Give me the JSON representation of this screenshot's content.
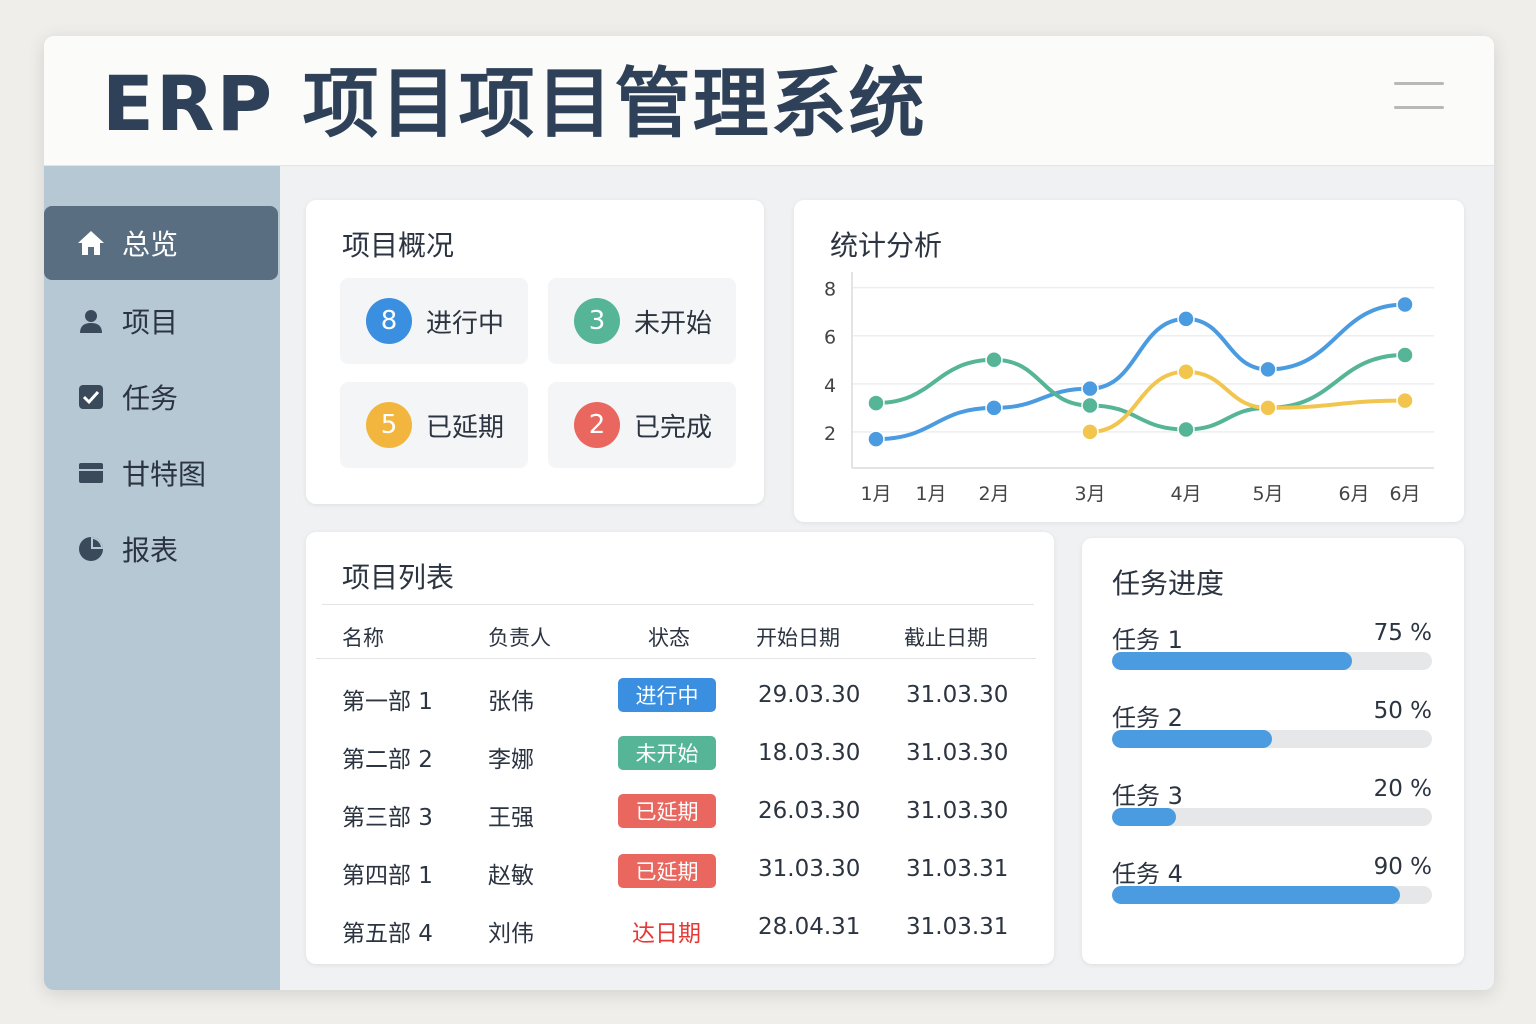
{
  "app": {
    "title": "ERP   项目项目管理系统"
  },
  "sidebar": {
    "items": [
      {
        "label": "总览",
        "icon": "home-icon"
      },
      {
        "label": "项目",
        "icon": "user-icon"
      },
      {
        "label": "任务",
        "icon": "checkbox-icon"
      },
      {
        "label": "甘特图",
        "icon": "gantt-icon"
      },
      {
        "label": "报表",
        "icon": "pie-chart-icon"
      }
    ]
  },
  "overview": {
    "title": "项目概况",
    "stats": [
      {
        "count": "8",
        "label": "进行中",
        "color": "#3a8fe0"
      },
      {
        "count": "3",
        "label": "未开始",
        "color": "#55b596"
      },
      {
        "count": "5",
        "label": "已延期",
        "color": "#f2b53d"
      },
      {
        "count": "2",
        "label": "已完成",
        "color": "#e9675f"
      }
    ]
  },
  "chart": {
    "title": "统计分析"
  },
  "chart_data": {
    "type": "line",
    "title": "统计分析",
    "x": [
      "1月",
      "1月",
      "2月",
      "3月",
      "4月",
      "5月",
      "6月",
      "6月"
    ],
    "yticks": [
      2,
      4,
      6,
      8
    ],
    "ylim": [
      0.5,
      8.4
    ],
    "grid": true,
    "series": [
      {
        "color": "#4a9be0",
        "points": [
          [
            0,
            1.7
          ],
          [
            2,
            3.0
          ],
          [
            3,
            3.8
          ],
          [
            4,
            6.7
          ],
          [
            5,
            4.6
          ],
          [
            7,
            7.3
          ]
        ]
      },
      {
        "color": "#55b596",
        "points": [
          [
            0,
            3.2
          ],
          [
            2,
            5.0
          ],
          [
            3,
            3.1
          ],
          [
            4,
            2.1
          ],
          [
            5,
            3.0
          ],
          [
            7,
            5.2
          ]
        ]
      },
      {
        "color": "#f2c64e",
        "points": [
          [
            3,
            2.0
          ],
          [
            4,
            4.5
          ],
          [
            5,
            3.0
          ],
          [
            7,
            3.3
          ]
        ]
      }
    ]
  },
  "project_list": {
    "title": "项目列表",
    "columns": [
      "名称",
      "负责人",
      "状态",
      "开始日期",
      "截止日期"
    ],
    "rows": [
      {
        "name": "第一部 1",
        "owner": "张伟",
        "status": "进行中",
        "status_color": "#3a8fe0",
        "start": "29.03.30",
        "end": "31.03.30"
      },
      {
        "name": "第二部 2",
        "owner": "李娜",
        "status": "未开始",
        "status_color": "#55b596",
        "start": "18.03.30",
        "end": "31.03.30"
      },
      {
        "name": "第三部 3",
        "owner": "王强",
        "status": "已延期",
        "status_color": "#e9675f",
        "start": "26.03.30",
        "end": "31.03.30"
      },
      {
        "name": "第四部 1",
        "owner": "赵敏",
        "status": "已延期",
        "status_color": "#e9675f",
        "start": "31.03.30",
        "end": "31.03.31"
      },
      {
        "name": "第五部 4",
        "owner": "刘伟",
        "status": "达日期",
        "status_color": "#e53935",
        "start": "28.04.31",
        "end": "31.03.31"
      }
    ]
  },
  "task_progress": {
    "title": "任务进度",
    "items": [
      {
        "label": "任务 1",
        "value": "75 %",
        "fraction": 0.75
      },
      {
        "label": "任务 2",
        "value": "50 %",
        "fraction": 0.5
      },
      {
        "label": "任务 3",
        "value": "20 %",
        "fraction": 0.2
      },
      {
        "label": "任务 4",
        "value": "90 %",
        "fraction": 0.9
      }
    ]
  }
}
